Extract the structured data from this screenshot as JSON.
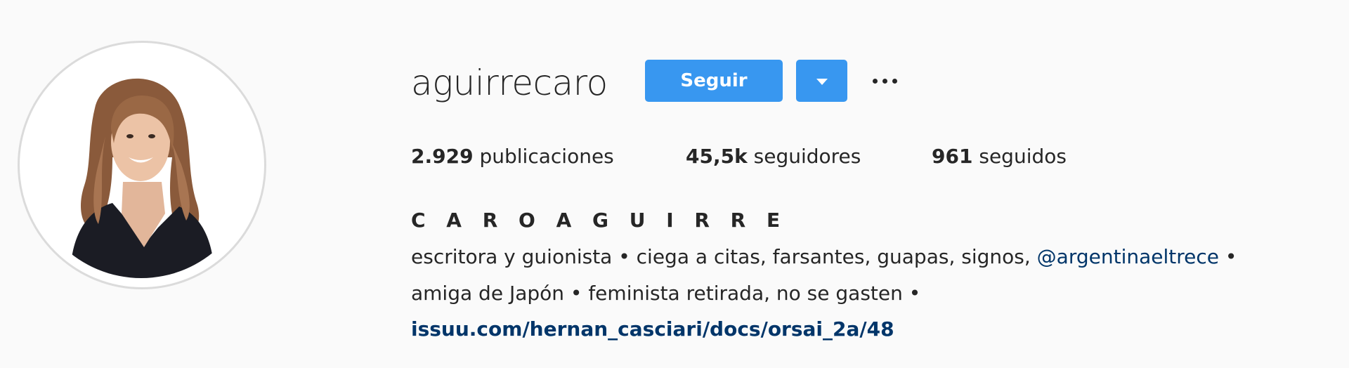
{
  "profile": {
    "username": "aguirrecaro",
    "avatar_icon": "profile-photo",
    "full_name": "C A R O A G U I R R E",
    "actions": {
      "follow_label": "Seguir",
      "dropdown_icon": "caret-down-icon",
      "more_icon": "more-horizontal-icon"
    },
    "stats": {
      "posts": {
        "count": "2.929",
        "label": "publicaciones"
      },
      "followers": {
        "count": "45,5k",
        "label": "seguidores"
      },
      "following": {
        "count": "961",
        "label": "seguidos"
      }
    },
    "bio": {
      "line1_text": "escritora y guionista • ciega a citas, farsantes, guapas, signos,",
      "line1_mention": "@argentinaeltrece",
      "line1_tail": "•",
      "line2_text": "amiga de Japón • feminista retirada, no se gasten •",
      "website": "issuu.com/hernan_casciari/docs/orsai_2a/48"
    }
  },
  "colors": {
    "background": "#fafafa",
    "accent": "#3897f0",
    "text": "#262626",
    "link": "#003569",
    "avatar_ring": "#dbdbdb"
  }
}
